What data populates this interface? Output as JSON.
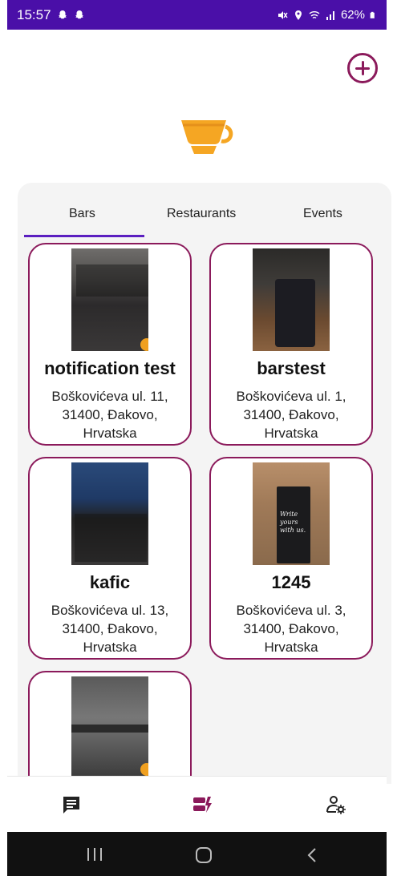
{
  "status_bar": {
    "time": "15:57",
    "battery": "62%",
    "icons": [
      "snapchat-icon",
      "snapchat-icon",
      "mute-icon",
      "location-icon",
      "wifi-icon",
      "signal-icon",
      "battery-icon"
    ]
  },
  "header": {
    "add_icon": "plus-circle-icon",
    "logo_icon": "coffee-cup-icon"
  },
  "tabs": [
    {
      "label": "Bars",
      "active": true
    },
    {
      "label": "Restaurants",
      "active": false
    },
    {
      "label": "Events",
      "active": false
    }
  ],
  "places": [
    {
      "name": "notification test",
      "address": "Boškovićeva ul. 11, 31400, Đakovo, Hrvatska",
      "photo": "laptop"
    },
    {
      "name": "barstest",
      "address": "Boškovićeva ul. 1, 31400, Đakovo, Hrvatska",
      "photo": "phone"
    },
    {
      "name": "kafic",
      "address": "Boškovićeva ul. 13, 31400, Đakovo, Hrvatska",
      "photo": "code"
    },
    {
      "name": "1245",
      "address": "Boškovićeva ul. 3, 31400, Đakovo, Hrvatska",
      "photo": "book"
    },
    {
      "name": "",
      "address": "",
      "photo": "blur"
    }
  ],
  "bookmark_text": "Write yours with us.",
  "bottom_nav": [
    {
      "icon": "chat-icon"
    },
    {
      "icon": "places-icon"
    },
    {
      "icon": "user-settings-icon"
    }
  ],
  "colors": {
    "accent": "#8b1a5b",
    "status_bar": "#4a0fa8",
    "tab_indicator": "#5b1fc0",
    "logo": "#f5a623"
  }
}
